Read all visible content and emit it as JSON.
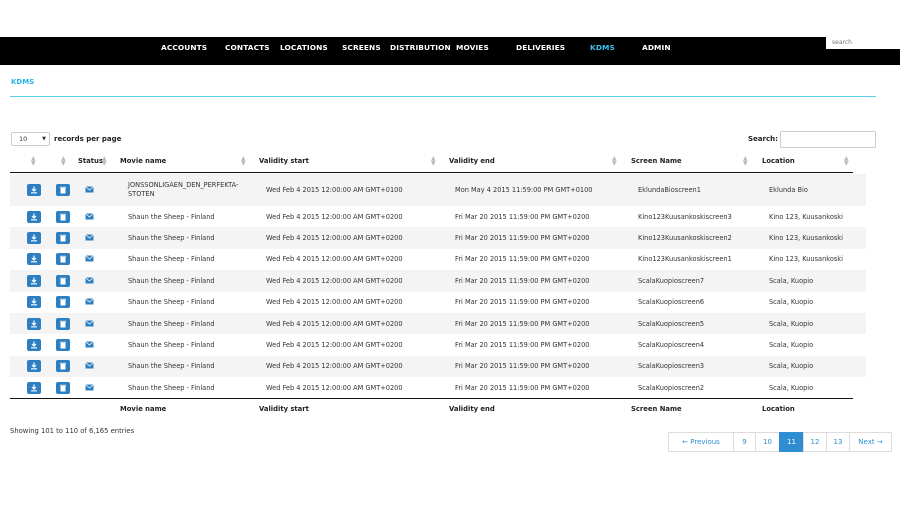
{
  "nav": {
    "items": [
      {
        "label": "ACCOUNTS",
        "active": false
      },
      {
        "label": "CONTACTS",
        "active": false
      },
      {
        "label": "LOCATIONS",
        "active": false
      },
      {
        "label": "SCREENS",
        "active": false
      },
      {
        "label": "DISTRIBUTION",
        "active": false
      },
      {
        "label": "MOVIES",
        "active": false
      },
      {
        "label": "DELIVERIES",
        "active": false
      },
      {
        "label": "KDMS",
        "active": true
      },
      {
        "label": "ADMIN",
        "active": false
      }
    ],
    "search_placeholder": "search"
  },
  "page": {
    "title": "KDMS"
  },
  "table_controls": {
    "length_value": "10",
    "length_label": "records per page",
    "search_label": "Search:",
    "search_value": ""
  },
  "columns": {
    "status": "Status",
    "movie": "Movie name",
    "start": "Validity start",
    "end": "Validity end",
    "screen": "Screen Name",
    "location": "Location"
  },
  "rows": [
    {
      "movie": "JONSSONLIGAEN_DEN_PERFEKTA-STOTEN",
      "start": "Wed Feb 4 2015 12:00:00 AM GMT+0100",
      "end": "Mon May 4 2015 11:59:00 PM GMT+0100",
      "screen": "EklundaBioscreen1",
      "location": "Eklunda Bio"
    },
    {
      "movie": "Shaun the Sheep - Finland",
      "start": "Wed Feb 4 2015 12:00:00 AM GMT+0200",
      "end": "Fri Mar 20 2015 11:59:00 PM GMT+0200",
      "screen": "Kino123Kuusankoskiscreen3",
      "location": "Kino 123, Kuusankoski"
    },
    {
      "movie": "Shaun the Sheep - Finland",
      "start": "Wed Feb 4 2015 12:00:00 AM GMT+0200",
      "end": "Fri Mar 20 2015 11:59:00 PM GMT+0200",
      "screen": "Kino123Kuusankoskiscreen2",
      "location": "Kino 123, Kuusankoski"
    },
    {
      "movie": "Shaun the Sheep - Finland",
      "start": "Wed Feb 4 2015 12:00:00 AM GMT+0200",
      "end": "Fri Mar 20 2015 11:59:00 PM GMT+0200",
      "screen": "Kino123Kuusankoskiscreen1",
      "location": "Kino 123, Kuusankoski"
    },
    {
      "movie": "Shaun the Sheep - Finland",
      "start": "Wed Feb 4 2015 12:00:00 AM GMT+0200",
      "end": "Fri Mar 20 2015 11:59:00 PM GMT+0200",
      "screen": "ScalaKuopioscreen7",
      "location": "Scala, Kuopio"
    },
    {
      "movie": "Shaun the Sheep - Finland",
      "start": "Wed Feb 4 2015 12:00:00 AM GMT+0200",
      "end": "Fri Mar 20 2015 11:59:00 PM GMT+0200",
      "screen": "ScalaKuopioscreen6",
      "location": "Scala, Kuopio"
    },
    {
      "movie": "Shaun the Sheep - Finland",
      "start": "Wed Feb 4 2015 12:00:00 AM GMT+0200",
      "end": "Fri Mar 20 2015 11:59:00 PM GMT+0200",
      "screen": "ScalaKuopioscreen5",
      "location": "Scala, Kuopio"
    },
    {
      "movie": "Shaun the Sheep - Finland",
      "start": "Wed Feb 4 2015 12:00:00 AM GMT+0200",
      "end": "Fri Mar 20 2015 11:59:00 PM GMT+0200",
      "screen": "ScalaKuopioscreen4",
      "location": "Scala, Kuopio"
    },
    {
      "movie": "Shaun the Sheep - Finland",
      "start": "Wed Feb 4 2015 12:00:00 AM GMT+0200",
      "end": "Fri Mar 20 2015 11:59:00 PM GMT+0200",
      "screen": "ScalaKuopioscreen3",
      "location": "Scala, Kuopio"
    },
    {
      "movie": "Shaun the Sheep - Finland",
      "start": "Wed Feb 4 2015 12:00:00 AM GMT+0200",
      "end": "Fri Mar 20 2015 11:59:00 PM GMT+0200",
      "screen": "ScalaKuopioscreen2",
      "location": "Scala, Kuopio"
    }
  ],
  "row_icons": [
    "download-icon",
    "trash-icon",
    "mail-icon"
  ],
  "info": "Showing 101 to 110 of 6,165 entries",
  "pagination": {
    "prev": "← Previous",
    "pages": [
      "9",
      "10",
      "11",
      "12",
      "13"
    ],
    "active_page": "11",
    "next": "Next →"
  },
  "colors": {
    "nav_bg": "#000000",
    "accent": "#29b6e4",
    "button": "#2d7fc1",
    "pager_active": "#2f8dd1"
  }
}
